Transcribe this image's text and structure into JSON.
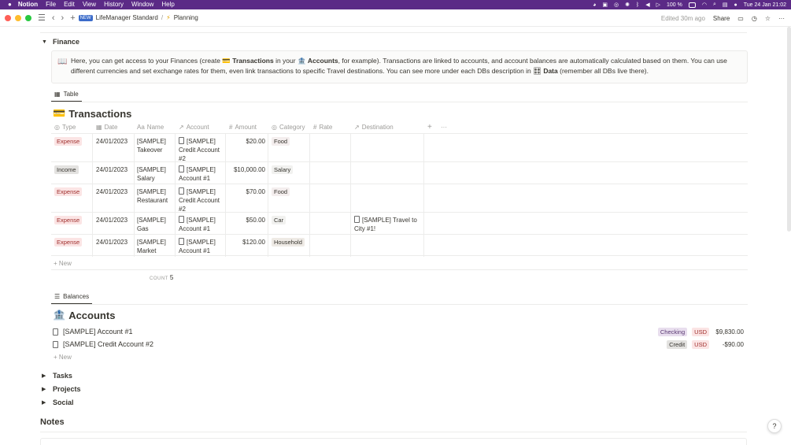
{
  "menubar": {
    "app": "Notion",
    "items": [
      "File",
      "Edit",
      "View",
      "History",
      "Window",
      "Help"
    ],
    "battery": "100 %",
    "clock": "Tue 24 Jan  21:02"
  },
  "titlebar": {
    "workspace": "LifeManager Standard",
    "workspace_badge": "NEW",
    "separator": "/",
    "page_icon": "⚡",
    "page": "Planning",
    "edited": "Edited 30m ago",
    "share": "Share"
  },
  "finance": {
    "toggle": "Finance",
    "callout_icon": "📖",
    "callout": {
      "p1": "Here, you can get access to your Finances (create ",
      "tx_icon": "💳",
      "tx_link": "Transactions",
      "p2": " in your ",
      "acc_icon": "🏦",
      "acc_link": "Accounts",
      "p3": ", for example). Transactions are linked to accounts, and account balances are automatically calculated based on them. You can use different currencies and set exchange rates for them, even link transactions to specific Travel destinations. You can see more under each DBs description in ",
      "data_icon": "🎛",
      "data_link": "Data",
      "p4": " (remember all DBs live there)."
    }
  },
  "transactions": {
    "view_tab": "Table",
    "icon": "💳",
    "title": "Transactions",
    "columns": [
      {
        "icon": "◎",
        "label": "Type"
      },
      {
        "icon": "▦",
        "label": "Date"
      },
      {
        "icon": "Aa",
        "label": "Name"
      },
      {
        "icon": "↗",
        "label": "Account"
      },
      {
        "icon": "#",
        "label": "Amount"
      },
      {
        "icon": "◎",
        "label": "Category"
      },
      {
        "icon": "#",
        "label": "Rate"
      },
      {
        "icon": "↗",
        "label": "Destination"
      }
    ],
    "add_col": "+",
    "more": "···",
    "rows": [
      {
        "type": "Expense",
        "date": "24/01/2023",
        "name": [
          "[SAMPLE]",
          "Takeover"
        ],
        "account": [
          "[SAMPLE]",
          "Credit Account",
          "#2"
        ],
        "amount": "$20.00",
        "category": "Food",
        "rate": "",
        "destination": []
      },
      {
        "type": "Income",
        "date": "24/01/2023",
        "name": [
          "[SAMPLE]",
          "Salary"
        ],
        "account": [
          "[SAMPLE]",
          "Account #1"
        ],
        "amount": "$10,000.00",
        "category": "Salary",
        "rate": "",
        "destination": []
      },
      {
        "type": "Expense",
        "date": "24/01/2023",
        "name": [
          "[SAMPLE]",
          "Restaurant"
        ],
        "account": [
          "[SAMPLE]",
          "Credit Account",
          "#2"
        ],
        "amount": "$70.00",
        "category": "Food",
        "rate": "",
        "destination": []
      },
      {
        "type": "Expense",
        "date": "24/01/2023",
        "name": [
          "[SAMPLE]",
          "Gas"
        ],
        "account": [
          "[SAMPLE]",
          "Account #1"
        ],
        "amount": "$50.00",
        "category": "Car",
        "rate": "",
        "destination": [
          "[SAMPLE] Travel to",
          "City #1!"
        ]
      },
      {
        "type": "Expense",
        "date": "24/01/2023",
        "name": [
          "[SAMPLE]",
          "Market"
        ],
        "account": [
          "[SAMPLE]",
          "Account #1"
        ],
        "amount": "$120.00",
        "category": "Household",
        "rate": "",
        "destination": []
      }
    ],
    "new_label": "New",
    "count_label": "COUNT",
    "count_value": "5"
  },
  "accounts": {
    "view_tab": "Balances",
    "icon": "🏦",
    "title": "Accounts",
    "rows": [
      {
        "name": "[SAMPLE] Account #1",
        "type": "Checking",
        "currency": "USD",
        "balance": "$9,830.00"
      },
      {
        "name": "[SAMPLE] Credit Account #2",
        "type": "Credit",
        "currency": "USD",
        "balance": "-$90.00"
      }
    ],
    "new_label": "New"
  },
  "collapsed": [
    "Tasks",
    "Projects",
    "Social"
  ],
  "notes_heading": "Notes",
  "help": "?",
  "colors": {
    "expense_bg": "#fbe4e4",
    "expense_fg": "#9f2f2d",
    "income_bg": "#e3e2e0",
    "income_fg": "#37352f",
    "food_bg": "#f4eeee",
    "salary_bg": "#f1f1ef",
    "car_bg": "#f1f1ef",
    "household_bg": "#eeeae5",
    "checking_bg": "#e8deee",
    "checking_fg": "#5a3a73",
    "credit_bg": "#e3e2e0",
    "usd_bg": "#fbe4e4",
    "usd_fg": "#9f2f2d",
    "menubar_bg": "#5b2a86"
  }
}
